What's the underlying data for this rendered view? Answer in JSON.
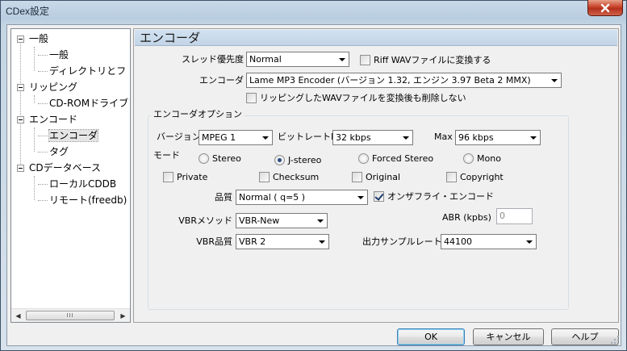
{
  "window": {
    "title": "CDex設定",
    "accent_color": "#c8432a",
    "close_icon": "close-x-icon"
  },
  "tree": {
    "items": [
      {
        "label": "一般",
        "level": 0,
        "expander": "-"
      },
      {
        "label": "一般",
        "level": 1
      },
      {
        "label": "ディレクトリとフ",
        "level": 1
      },
      {
        "label": "リッピング",
        "level": 0,
        "expander": "-"
      },
      {
        "label": "CD-ROMドライブ",
        "level": 1
      },
      {
        "label": "エンコード",
        "level": 0,
        "expander": "-"
      },
      {
        "label": "エンコーダ",
        "level": 1,
        "selected": true
      },
      {
        "label": "タグ",
        "level": 1
      },
      {
        "label": "CDデータベース",
        "level": 0,
        "expander": "-"
      },
      {
        "label": "ローカルCDDB",
        "level": 1
      },
      {
        "label": "リモート(freedb)",
        "level": 1
      }
    ],
    "scroll_left": "◀",
    "scroll_right": "▶",
    "scroll_thumb": "III"
  },
  "panel": {
    "header": "エンコーダ",
    "thread_priority": {
      "label": "スレッド優先度",
      "value": "Normal"
    },
    "riff_wav": {
      "label": "Riff WAVファイルに変換する",
      "checked": false
    },
    "encoder": {
      "label": "エンコーダ",
      "value": "Lame MP3 Encoder (バージョン 1.32, エンジン 3.97 Beta 2 MMX)"
    },
    "delete_after": {
      "label": "リッピングしたWAVファイルを変換後も削除しない",
      "checked": false
    },
    "options": {
      "title": "エンコーダオプション",
      "version": {
        "label": "バージョン",
        "value": "MPEG 1"
      },
      "bitrate_min": {
        "label": "ビットレートMin",
        "value": "32 kbps"
      },
      "bitrate_max": {
        "label": "Max",
        "value": "96 kbps"
      },
      "mode": {
        "label": "モード",
        "choices": [
          "Stereo",
          "J-stereo",
          "Forced Stereo",
          "Mono"
        ],
        "selected": "J-stereo"
      },
      "flags": [
        {
          "label": "Private",
          "checked": false
        },
        {
          "label": "Checksum",
          "checked": false
        },
        {
          "label": "Original",
          "checked": false
        },
        {
          "label": "Copyright",
          "checked": false
        }
      ],
      "quality": {
        "label": "品質",
        "value": "Normal ( q=5 )"
      },
      "on_the_fly": {
        "label": "オンザフライ・エンコード",
        "checked": true
      },
      "vbr_method": {
        "label": "VBRメソッド",
        "value": "VBR-New"
      },
      "abr": {
        "label": "ABR (kpbs)",
        "value": "0"
      },
      "vbr_quality": {
        "label": "VBR品質",
        "value": "VBR 2"
      },
      "sample_rate": {
        "label": "出力サンプルレート",
        "value": "44100"
      }
    }
  },
  "buttons": {
    "ok": "OK",
    "cancel": "キャンセル",
    "help": "ヘルプ"
  }
}
